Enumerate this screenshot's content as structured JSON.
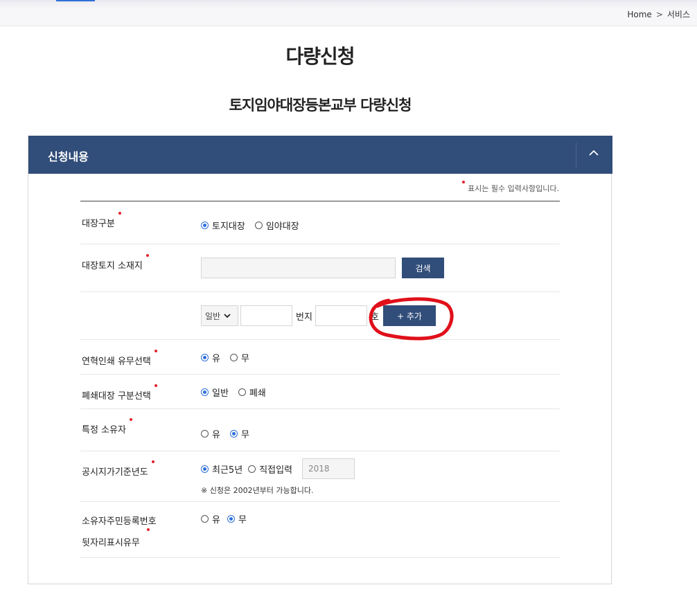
{
  "breadcrumb": {
    "home": "Home",
    "separator": ">",
    "current": "서비스"
  },
  "page_title": "다량신청",
  "sub_title": "토지임야대장등본교부 다량신청",
  "panel": {
    "title": "신청내용",
    "required_note": "표시는 필수 입력사항입니다.",
    "rows": {
      "ledger_type": {
        "label": "대장구분",
        "options": [
          "토지대장",
          "임야대장"
        ],
        "selected": "토지대장"
      },
      "land_location": {
        "label": "대장토지 소재지",
        "value": "",
        "search_label": "검색"
      },
      "lot_number": {
        "select_value": "일반",
        "main_number_value": "",
        "main_number_unit": "번지",
        "sub_number_value": "",
        "sub_number_unit": "호",
        "add_label": "+ 추가"
      },
      "yearly_print": {
        "label": "연혁인쇄 유무선택",
        "options": [
          "유",
          "무"
        ],
        "selected": "유"
      },
      "closed_ledger": {
        "label": "폐쇄대장 구분선택",
        "options": [
          "일반",
          "폐쇄"
        ],
        "selected": "일반"
      },
      "specific_owner": {
        "label": "특정 소유자",
        "options": [
          "유",
          "무"
        ],
        "selected": "무"
      },
      "base_year": {
        "label": "공시지가기준년도",
        "options": [
          "최근5년",
          "직접입력"
        ],
        "selected": "최근5년",
        "year_value": "2018",
        "note": "※ 신청은 2002년부터 가능합니다."
      },
      "owner_id": {
        "label_line1": "소유자주민등록번호",
        "label_line2": "뒷자리표시유무",
        "options": [
          "유",
          "무"
        ],
        "selected": "무"
      }
    }
  },
  "colors": {
    "panel_header": "#314d79",
    "radio_selected": "#2f6fd8",
    "required_dot": "#e3202a",
    "annotation": "#e0101a"
  }
}
